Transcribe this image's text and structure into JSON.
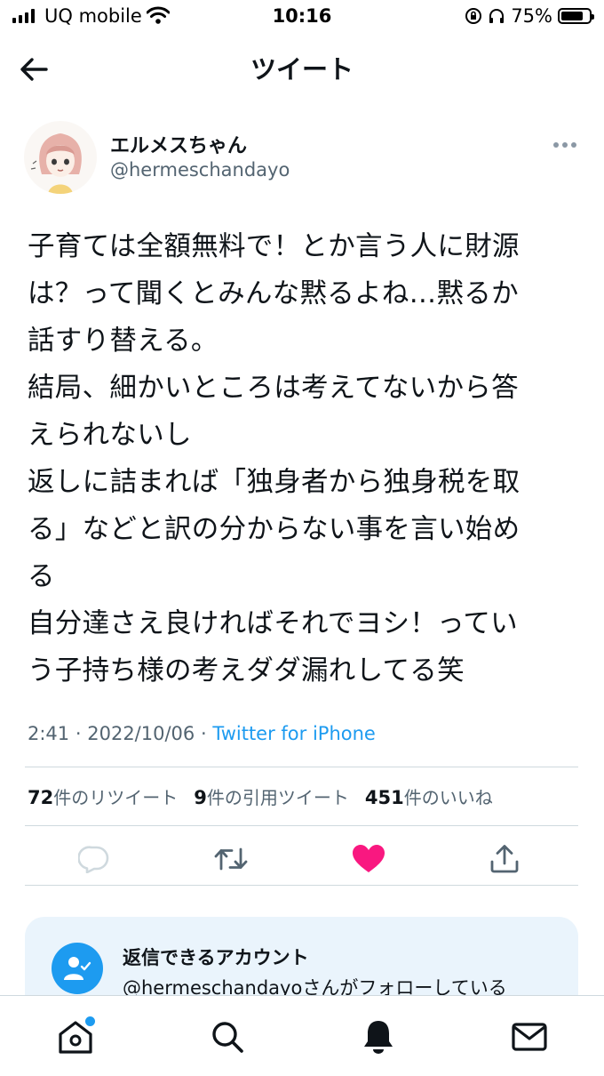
{
  "status_bar": {
    "carrier": "UQ mobile",
    "time": "10:16",
    "battery": "75%",
    "icons": [
      "signal-icon",
      "wifi-icon",
      "orientation-lock-icon",
      "headphones-icon",
      "battery-icon"
    ]
  },
  "header": {
    "title": "ツイート",
    "back_icon": "back-arrow-icon"
  },
  "tweet": {
    "author": {
      "display_name": "エルメスちゃん",
      "handle": "@hermeschandayo"
    },
    "text_lines": [
      "子育ては全額無料で！とか言う人に財源",
      "は？って聞くとみんな黙るよね…黙るか",
      "話すり替える。",
      "結局、細かいところは考えてないから答",
      "えられないし",
      "返しに詰まれば「独身者から独身税を取",
      "る」などと訳の分からない事を言い始め",
      "る",
      "自分達さえ良ければそれでヨシ！ってい",
      "う子持ち様の考えダダ漏れしてる笑"
    ],
    "time": "2:41",
    "date": "2022/10/06",
    "separator": "·",
    "source": "Twitter for iPhone",
    "stats": {
      "retweets_count": "72",
      "retweets_label": "件のリツイート",
      "quotes_count": "9",
      "quotes_label": "件の引用ツイート",
      "likes_count": "451",
      "likes_label": "件のいいね"
    },
    "actions": {
      "reply_icon": "reply-icon",
      "retweet_icon": "retweet-icon",
      "like_icon": "heart-filled-icon",
      "share_icon": "share-icon",
      "like_color": "#f91880"
    }
  },
  "reply_settings": {
    "title": "返信できるアカウント",
    "handle": "@hermeschandayo",
    "description": "さんがフォローしている"
  },
  "bottom_nav": {
    "items": [
      "home-icon",
      "search-icon",
      "notifications-icon",
      "messages-icon"
    ],
    "accent_color": "#1d9bf0"
  }
}
